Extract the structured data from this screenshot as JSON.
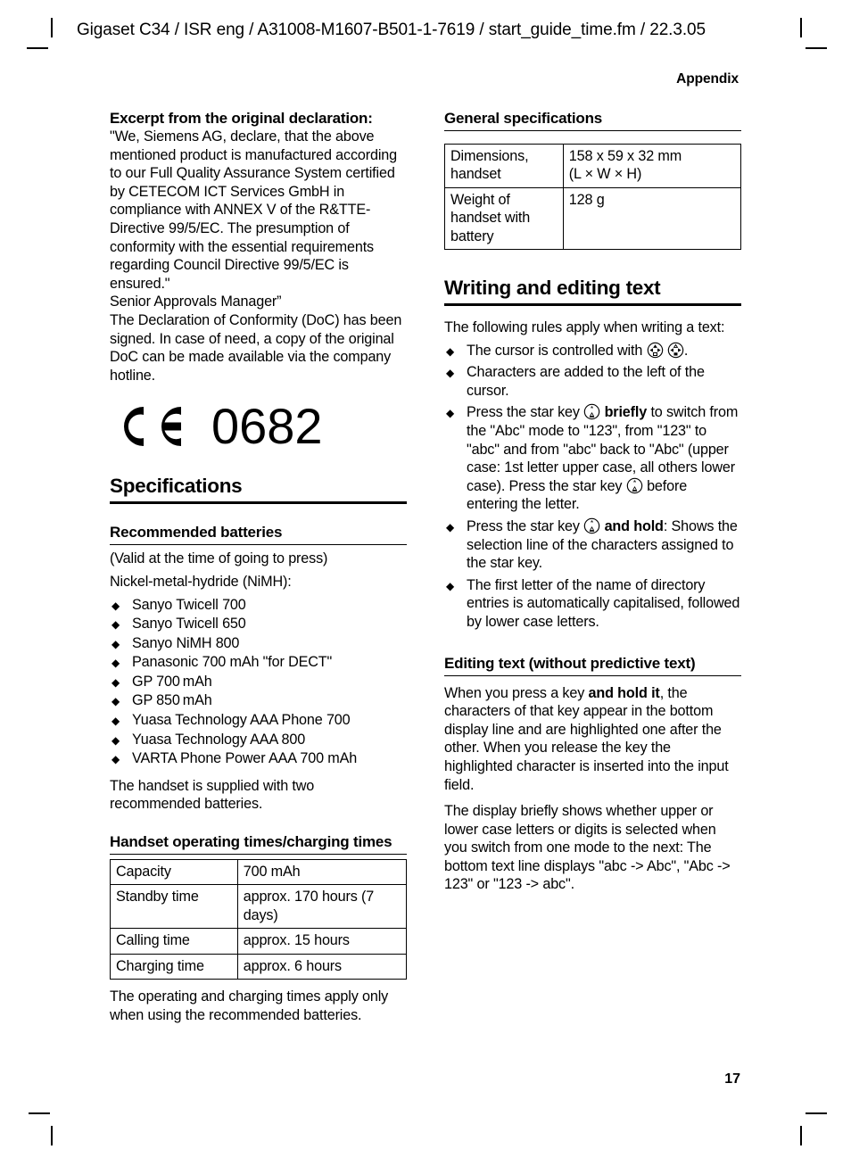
{
  "header": {
    "doc_line": "Gigaset C34 / ISR eng / A31008-M1607-B501-1-7619 / start_guide_time.fm / 22.3.05",
    "section": "Appendix"
  },
  "footer": {
    "page_number": "17"
  },
  "left_column": {
    "declaration": {
      "heading": "Excerpt from the original declaration:",
      "paragraph_1": "\"We, Siemens AG, declare, that the above mentioned product is manufactured according to our Full Quality Assurance System certified by CETECOM ICT Services GmbH in compliance with ANNEX V of the R&TTE-Directive 99/5/EC. The presumption of conformity with the essential requirements regarding Council Directive 99/5/EC is ensured.\"",
      "signature_line": "Senior Approvals Manager”",
      "paragraph_2": "The Declaration of Conformity (DoC) has been signed. In case of need, a copy of the original DoC can be made available via the company hotline."
    },
    "ce_mark": {
      "icon": "ce-mark-icon",
      "notified_body_number": "0682"
    },
    "specifications_heading": "Specifications",
    "batteries": {
      "heading": "Recommended batteries",
      "validity_note": "(Valid at the time of going to press)",
      "chemistry": "Nickel-metal-hydride (NiMH):",
      "items": [
        "Sanyo Twicell 700",
        "Sanyo Twicell 650",
        "Sanyo NiMH 800",
        "Panasonic 700 mAh \"for DECT\"",
        "GP 700 mAh",
        "GP 850 mAh",
        "Yuasa Technology AAA Phone 700",
        "Yuasa Technology AAA 800",
        "VARTA Phone Power AAA 700 mAh"
      ],
      "supplied_note": "The handset is supplied with two recommended batteries."
    },
    "operating_times": {
      "heading": "Handset operating times/charging times",
      "rows": [
        {
          "label": "Capacity",
          "value": "700 mAh"
        },
        {
          "label": "Standby time",
          "value": "approx. 170 hours (7 days)"
        },
        {
          "label": "Calling time",
          "value": "approx. 15 hours"
        },
        {
          "label": "Charging time",
          "value": "approx. 6 hours"
        }
      ],
      "footnote": "The operating and charging times apply only when using the recommended batteries."
    }
  },
  "right_column": {
    "general_specs": {
      "heading": "General specifications",
      "rows": [
        {
          "label": "Dimensions, handset",
          "value": "158 x 59 x 32 mm\n(L × W × H)"
        },
        {
          "label": "Weight of handset with battery",
          "value": "128 g"
        }
      ]
    },
    "writing": {
      "heading": "Writing and editing text",
      "intro": "The following rules apply when writing a text:",
      "bullets": [
        {
          "prefix": "The cursor is controlled with ",
          "icon_1": "navigation-key-up-down-icon",
          "icon_2": "navigation-key-left-right-icon",
          "suffix": "."
        },
        {
          "text": "Characters are added to the left of the cursor."
        },
        {
          "part_1": "Press the star key ",
          "icon_1": "star-key-icon",
          "bold_1": "briefly",
          "part_2": " to switch from the \"Abc\" mode to \"123\", from \"123\" to \"abc\" and from \"abc\" back to \"Abc\" (upper case: 1st letter upper case, all others lower case). Press the star key ",
          "icon_2": "star-key-icon",
          "part_3": " before entering the letter."
        },
        {
          "part_1": "Press the star key ",
          "icon_1": "star-key-icon",
          "bold_1": "and hold",
          "part_2": ": Shows the selection line of the characters assigned to the star key."
        },
        {
          "text": "The first letter of the name of directory entries is automatically capitalised, followed by lower case letters."
        }
      ]
    },
    "editing": {
      "heading": "Editing text (without predictive text)",
      "paragraph_1_part_1": "When you press a key ",
      "paragraph_1_bold": "and hold it",
      "paragraph_1_part_2": ", the characters of that key appear in the bottom display line and are highlighted one after the other. When you release the key the highlighted character is inserted into the input field.",
      "paragraph_2": "The display briefly shows whether upper or lower case letters or digits is selected when you switch from one mode to the next: The bottom text line displays \"abc -> Abc\", \"Abc -> 123\" or \"123 -> abc\"."
    }
  }
}
